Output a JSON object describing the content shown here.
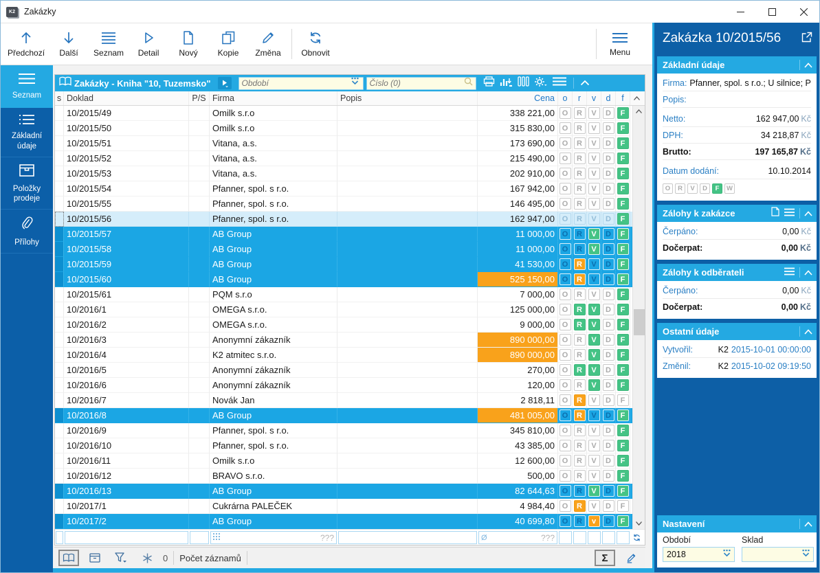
{
  "colors": {
    "accent": "#24a9e2",
    "dark_blue": "#0c5fa8",
    "selected_row": "#1ba6e4",
    "orange": "#f9a21b",
    "green": "#44c385",
    "input_yellow": "#fdfce4"
  },
  "window": {
    "title": "Zakázky",
    "app_icon_text": "K2"
  },
  "toolbar": {
    "buttons": [
      {
        "label": "Předchozí",
        "icon": "arrow-up"
      },
      {
        "label": "Další",
        "icon": "arrow-down"
      },
      {
        "label": "Seznam",
        "icon": "list"
      },
      {
        "label": "Detail",
        "icon": "play-outline"
      },
      {
        "label": "Nový",
        "icon": "document"
      },
      {
        "label": "Kopie",
        "icon": "copy"
      },
      {
        "label": "Změna",
        "icon": "pencil"
      },
      {
        "label": "Obnovit",
        "icon": "refresh"
      }
    ],
    "menu_label": "Menu"
  },
  "sidebar": {
    "items": [
      {
        "label": "Seznam",
        "active": true
      },
      {
        "label": "Základní údaje",
        "active": false
      },
      {
        "label": "Položky prodeje",
        "active": false
      },
      {
        "label": "Přílohy",
        "active": false
      }
    ]
  },
  "browse": {
    "title": "Zakázky - Kniha \"10, Tuzemsko\"",
    "obdobi_placeholder": "Období",
    "cislo_placeholder": "Číslo (0)",
    "columns": [
      "s",
      "Doklad",
      "P/S",
      "Firma",
      "Popis",
      "Cena",
      "o",
      "r",
      "v",
      "d",
      "f"
    ],
    "rows": [
      {
        "doklad": "10/2015/49",
        "firma": "Omilk s.r.o",
        "cena": "338 221,00",
        "hl": false,
        "state": "normal",
        "flags": [
          {
            "k": "O",
            "s": "off"
          },
          {
            "k": "R",
            "s": "off"
          },
          {
            "k": "V",
            "s": "off"
          },
          {
            "k": "D",
            "s": "off"
          },
          {
            "k": "F",
            "s": "green"
          }
        ]
      },
      {
        "doklad": "10/2015/50",
        "firma": "Omilk s.r.o",
        "cena": "315 830,00",
        "hl": false,
        "state": "normal",
        "flags": [
          {
            "k": "O",
            "s": "off"
          },
          {
            "k": "R",
            "s": "off"
          },
          {
            "k": "V",
            "s": "off"
          },
          {
            "k": "D",
            "s": "off"
          },
          {
            "k": "F",
            "s": "green"
          }
        ]
      },
      {
        "doklad": "10/2015/51",
        "firma": "Vitana, a.s.",
        "cena": "173 690,00",
        "hl": false,
        "state": "normal",
        "flags": [
          {
            "k": "O",
            "s": "off"
          },
          {
            "k": "R",
            "s": "off"
          },
          {
            "k": "V",
            "s": "off"
          },
          {
            "k": "D",
            "s": "off"
          },
          {
            "k": "F",
            "s": "green"
          }
        ]
      },
      {
        "doklad": "10/2015/52",
        "firma": "Vitana, a.s.",
        "cena": "215 490,00",
        "hl": false,
        "state": "normal",
        "flags": [
          {
            "k": "O",
            "s": "off"
          },
          {
            "k": "R",
            "s": "off"
          },
          {
            "k": "V",
            "s": "off"
          },
          {
            "k": "D",
            "s": "off"
          },
          {
            "k": "F",
            "s": "green"
          }
        ]
      },
      {
        "doklad": "10/2015/53",
        "firma": "Vitana, a.s.",
        "cena": "202 910,00",
        "hl": false,
        "state": "normal",
        "flags": [
          {
            "k": "O",
            "s": "off"
          },
          {
            "k": "R",
            "s": "off"
          },
          {
            "k": "V",
            "s": "off"
          },
          {
            "k": "D",
            "s": "off"
          },
          {
            "k": "F",
            "s": "green"
          }
        ]
      },
      {
        "doklad": "10/2015/54",
        "firma": "Pfanner, spol. s r.o.",
        "cena": "167 942,00",
        "hl": false,
        "state": "normal",
        "flags": [
          {
            "k": "O",
            "s": "off"
          },
          {
            "k": "R",
            "s": "off"
          },
          {
            "k": "V",
            "s": "off"
          },
          {
            "k": "D",
            "s": "off"
          },
          {
            "k": "F",
            "s": "green"
          }
        ]
      },
      {
        "doklad": "10/2015/55",
        "firma": "Pfanner, spol. s r.o.",
        "cena": "146 495,00",
        "hl": false,
        "state": "normal",
        "flags": [
          {
            "k": "O",
            "s": "off"
          },
          {
            "k": "R",
            "s": "off"
          },
          {
            "k": "V",
            "s": "off"
          },
          {
            "k": "D",
            "s": "off"
          },
          {
            "k": "F",
            "s": "green"
          }
        ]
      },
      {
        "doklad": "10/2015/56",
        "firma": "Pfanner, spol. s r.o.",
        "cena": "162 947,00",
        "hl": false,
        "state": "current",
        "flags": [
          {
            "k": "O",
            "s": "off"
          },
          {
            "k": "R",
            "s": "off"
          },
          {
            "k": "V",
            "s": "off"
          },
          {
            "k": "D",
            "s": "off"
          },
          {
            "k": "F",
            "s": "green"
          }
        ]
      },
      {
        "doklad": "10/2015/57",
        "firma": "AB Group",
        "cena": "11 000,00",
        "hl": false,
        "state": "selected",
        "flags": [
          {
            "k": "O",
            "s": "off"
          },
          {
            "k": "R",
            "s": "off"
          },
          {
            "k": "V",
            "s": "green"
          },
          {
            "k": "D",
            "s": "off"
          },
          {
            "k": "F",
            "s": "green"
          }
        ]
      },
      {
        "doklad": "10/2015/58",
        "firma": "AB Group",
        "cena": "11 000,00",
        "hl": false,
        "state": "selected",
        "flags": [
          {
            "k": "O",
            "s": "off"
          },
          {
            "k": "R",
            "s": "off"
          },
          {
            "k": "V",
            "s": "green"
          },
          {
            "k": "D",
            "s": "off"
          },
          {
            "k": "F",
            "s": "green"
          }
        ]
      },
      {
        "doklad": "10/2015/59",
        "firma": "AB Group",
        "cena": "41 530,00",
        "hl": false,
        "state": "selected",
        "flags": [
          {
            "k": "O",
            "s": "off"
          },
          {
            "k": "R",
            "s": "orange"
          },
          {
            "k": "V",
            "s": "off"
          },
          {
            "k": "D",
            "s": "off"
          },
          {
            "k": "F",
            "s": "green"
          }
        ]
      },
      {
        "doklad": "10/2015/60",
        "firma": "AB Group",
        "cena": "525 150,00",
        "hl": true,
        "state": "selected",
        "flags": [
          {
            "k": "O",
            "s": "off"
          },
          {
            "k": "R",
            "s": "orange"
          },
          {
            "k": "V",
            "s": "off"
          },
          {
            "k": "D",
            "s": "off"
          },
          {
            "k": "F",
            "s": "green"
          }
        ]
      },
      {
        "doklad": "10/2015/61",
        "firma": "PQM s.r.o",
        "cena": "7 000,00",
        "hl": false,
        "state": "normal",
        "flags": [
          {
            "k": "O",
            "s": "off"
          },
          {
            "k": "R",
            "s": "off"
          },
          {
            "k": "V",
            "s": "off"
          },
          {
            "k": "D",
            "s": "off"
          },
          {
            "k": "F",
            "s": "green"
          }
        ]
      },
      {
        "doklad": "10/2016/1",
        "firma": "OMEGA s.r.o.",
        "cena": "125 000,00",
        "hl": false,
        "state": "normal",
        "flags": [
          {
            "k": "O",
            "s": "off"
          },
          {
            "k": "R",
            "s": "green"
          },
          {
            "k": "V",
            "s": "green"
          },
          {
            "k": "D",
            "s": "off"
          },
          {
            "k": "F",
            "s": "green"
          }
        ]
      },
      {
        "doklad": "10/2016/2",
        "firma": "OMEGA s.r.o.",
        "cena": "9 000,00",
        "hl": false,
        "state": "normal",
        "flags": [
          {
            "k": "O",
            "s": "off"
          },
          {
            "k": "R",
            "s": "green"
          },
          {
            "k": "V",
            "s": "green"
          },
          {
            "k": "D",
            "s": "off"
          },
          {
            "k": "F",
            "s": "green"
          }
        ]
      },
      {
        "doklad": "10/2016/3",
        "firma": "Anonymní zákazník",
        "cena": "890 000,00",
        "hl": true,
        "state": "normal",
        "flags": [
          {
            "k": "O",
            "s": "off"
          },
          {
            "k": "R",
            "s": "off"
          },
          {
            "k": "V",
            "s": "green"
          },
          {
            "k": "D",
            "s": "off"
          },
          {
            "k": "F",
            "s": "green"
          }
        ]
      },
      {
        "doklad": "10/2016/4",
        "firma": "K2 atmitec s.r.o.",
        "cena": "890 000,00",
        "hl": true,
        "state": "normal",
        "flags": [
          {
            "k": "O",
            "s": "off"
          },
          {
            "k": "R",
            "s": "off"
          },
          {
            "k": "V",
            "s": "green"
          },
          {
            "k": "D",
            "s": "off"
          },
          {
            "k": "F",
            "s": "green"
          }
        ]
      },
      {
        "doklad": "10/2016/5",
        "firma": "Anonymní zákazník",
        "cena": "270,00",
        "hl": false,
        "state": "normal",
        "flags": [
          {
            "k": "O",
            "s": "off"
          },
          {
            "k": "R",
            "s": "green"
          },
          {
            "k": "V",
            "s": "green"
          },
          {
            "k": "D",
            "s": "off"
          },
          {
            "k": "F",
            "s": "green"
          }
        ]
      },
      {
        "doklad": "10/2016/6",
        "firma": "Anonymní zákazník",
        "cena": "120,00",
        "hl": false,
        "state": "normal",
        "flags": [
          {
            "k": "O",
            "s": "off"
          },
          {
            "k": "R",
            "s": "off"
          },
          {
            "k": "V",
            "s": "green"
          },
          {
            "k": "D",
            "s": "off"
          },
          {
            "k": "F",
            "s": "green"
          }
        ]
      },
      {
        "doklad": "10/2016/7",
        "firma": "Novák Jan",
        "cena": "2 818,11",
        "hl": false,
        "state": "normal",
        "flags": [
          {
            "k": "O",
            "s": "off"
          },
          {
            "k": "R",
            "s": "orange"
          },
          {
            "k": "V",
            "s": "off"
          },
          {
            "k": "D",
            "s": "off"
          },
          {
            "k": "F",
            "s": "off"
          }
        ]
      },
      {
        "doklad": "10/2016/8",
        "firma": "AB Group",
        "cena": "481 005,00",
        "hl": true,
        "state": "selected",
        "flags": [
          {
            "k": "O",
            "s": "off"
          },
          {
            "k": "R",
            "s": "orange"
          },
          {
            "k": "V",
            "s": "off"
          },
          {
            "k": "D",
            "s": "off"
          },
          {
            "k": "F",
            "s": "green"
          }
        ]
      },
      {
        "doklad": "10/2016/9",
        "firma": "Pfanner, spol. s r.o.",
        "cena": "345 810,00",
        "hl": false,
        "state": "normal",
        "flags": [
          {
            "k": "O",
            "s": "off"
          },
          {
            "k": "R",
            "s": "off"
          },
          {
            "k": "V",
            "s": "off"
          },
          {
            "k": "D",
            "s": "off"
          },
          {
            "k": "F",
            "s": "green"
          }
        ]
      },
      {
        "doklad": "10/2016/10",
        "firma": "Pfanner, spol. s r.o.",
        "cena": "43 385,00",
        "hl": false,
        "state": "normal",
        "flags": [
          {
            "k": "O",
            "s": "off"
          },
          {
            "k": "R",
            "s": "off"
          },
          {
            "k": "V",
            "s": "off"
          },
          {
            "k": "D",
            "s": "off"
          },
          {
            "k": "F",
            "s": "green"
          }
        ]
      },
      {
        "doklad": "10/2016/11",
        "firma": "Omilk s.r.o",
        "cena": "12 600,00",
        "hl": false,
        "state": "normal",
        "flags": [
          {
            "k": "O",
            "s": "off"
          },
          {
            "k": "R",
            "s": "off"
          },
          {
            "k": "V",
            "s": "off"
          },
          {
            "k": "D",
            "s": "off"
          },
          {
            "k": "F",
            "s": "green"
          }
        ]
      },
      {
        "doklad": "10/2016/12",
        "firma": "BRAVO s.r.o.",
        "cena": "500,00",
        "hl": false,
        "state": "normal",
        "flags": [
          {
            "k": "O",
            "s": "off"
          },
          {
            "k": "R",
            "s": "off"
          },
          {
            "k": "V",
            "s": "off"
          },
          {
            "k": "D",
            "s": "off"
          },
          {
            "k": "F",
            "s": "green"
          }
        ]
      },
      {
        "doklad": "10/2016/13",
        "firma": "AB Group",
        "cena": "82 644,63",
        "hl": false,
        "state": "selected",
        "flags": [
          {
            "k": "O",
            "s": "off"
          },
          {
            "k": "R",
            "s": "off"
          },
          {
            "k": "V",
            "s": "green"
          },
          {
            "k": "D",
            "s": "off"
          },
          {
            "k": "F",
            "s": "green"
          }
        ]
      },
      {
        "doklad": "10/2017/1",
        "firma": "Cukrárna PALEČEK",
        "cena": "4 984,40",
        "hl": false,
        "state": "normal",
        "flags": [
          {
            "k": "O",
            "s": "off"
          },
          {
            "k": "R",
            "s": "orange"
          },
          {
            "k": "V",
            "s": "off"
          },
          {
            "k": "D",
            "s": "off"
          },
          {
            "k": "F",
            "s": "off"
          }
        ]
      },
      {
        "doklad": "10/2017/2",
        "firma": "AB Group",
        "cena": "40 699,80",
        "hl": false,
        "state": "selected",
        "flags": [
          {
            "k": "O",
            "s": "off"
          },
          {
            "k": "R",
            "s": "off"
          },
          {
            "k": "v",
            "s": "orange"
          },
          {
            "k": "D",
            "s": "off"
          },
          {
            "k": "F",
            "s": "green"
          }
        ]
      }
    ],
    "summary": {
      "firma_placeholder": "???",
      "cena_placeholder": "???",
      "avg_symbol": "Ø"
    },
    "statusbar": {
      "count": "0",
      "count_label": "Počet záznamů",
      "sigma": "Σ"
    }
  },
  "panel": {
    "title": "Zakázka 10/2015/56",
    "zakladni": {
      "title": "Základní údaje",
      "firma_label": "Firma:",
      "firma": "Pfanner, spol. s r.o.; U silnice; Pr...",
      "popis_label": "Popis:",
      "popis": "",
      "netto_label": "Netto:",
      "netto": "162 947,00",
      "dph_label": "DPH:",
      "dph": "34 218,87",
      "brutto_label": "Brutto:",
      "brutto": "197 165,87",
      "currency": "Kč",
      "datum_label": "Datum dodání:",
      "datum": "10.10.2014",
      "flags": [
        {
          "k": "O",
          "s": "off"
        },
        {
          "k": "R",
          "s": "off"
        },
        {
          "k": "V",
          "s": "off"
        },
        {
          "k": "D",
          "s": "off"
        },
        {
          "k": "F",
          "s": "green"
        },
        {
          "k": "W",
          "s": "off"
        }
      ]
    },
    "zalohy_zakazce": {
      "title": "Zálohy k zakázce",
      "cerpano_label": "Čerpáno:",
      "cerpano": "0,00",
      "docerpat_label": "Dočerpat:",
      "docerpat": "0,00",
      "currency": "Kč"
    },
    "zalohy_odberateli": {
      "title": "Zálohy k odběrateli",
      "cerpano_label": "Čerpáno:",
      "cerpano": "0,00",
      "docerpat_label": "Dočerpat:",
      "docerpat": "0,00",
      "currency": "Kč"
    },
    "ostatni": {
      "title": "Ostatní údaje",
      "vytvoril_label": "Vytvořil:",
      "vytvoril_user": "K2",
      "vytvoril_date": "2015-10-01 00:00:00",
      "zmenil_label": "Změnil:",
      "zmenil_user": "K2",
      "zmenil_date": "2015-10-02 09:19:50"
    },
    "nastaveni": {
      "title": "Nastavení",
      "obdobi_label": "Období",
      "obdobi_value": "2018",
      "sklad_label": "Sklad",
      "sklad_value": ""
    }
  }
}
